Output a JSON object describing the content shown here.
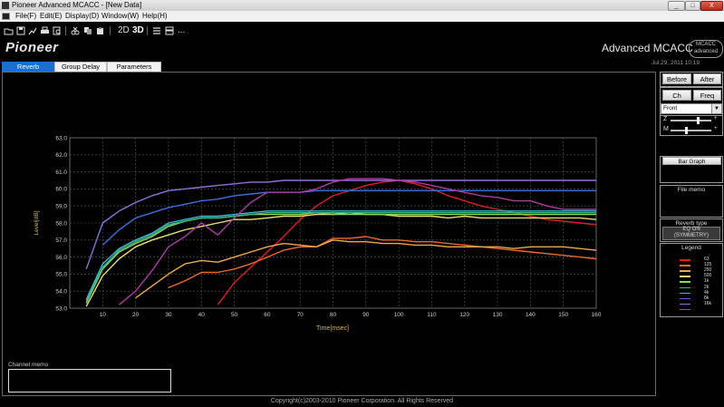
{
  "window": {
    "title": "Pioneer Advanced MCACC - [New Data]",
    "controls": [
      "_",
      "□",
      "X"
    ]
  },
  "menu": [
    "File(F)",
    "Edit(E)",
    "Display(D)",
    "Window(W)",
    "Help(H)"
  ],
  "toolbar": {
    "btn_2d": "2D",
    "btn_3d": "3D",
    "more": "..."
  },
  "header": {
    "logo": "Pioneer",
    "product": "Advanced MCACC",
    "badge": "MCACC advanced",
    "datetime": "Jul.29, 2011 10:19"
  },
  "tabs": [
    {
      "label": "Reverb",
      "active": true
    },
    {
      "label": "Group Delay",
      "active": false
    },
    {
      "label": "Parameters",
      "active": false
    }
  ],
  "right_panel": {
    "before": "Before",
    "after": "After",
    "ch": "Ch",
    "freq": "Freq",
    "channel_select": "Front",
    "z_label": "Z",
    "m_label": "M",
    "z_level": 0.65,
    "m_level": 0.35,
    "bar_graph": "Bar Graph",
    "file_memo": "File memo",
    "reverb_type_title": "Reverb type",
    "reverb_type_line1": "EQ ON",
    "reverb_type_line2": "(SYMMETRY)",
    "legend_title": "Legend"
  },
  "channel_memo": {
    "label": "Channel memo",
    "value": ""
  },
  "footer": {
    "copyright": "Copyright(c)2003-2010 Pioneer Corporation. All Rights Reserved"
  },
  "chart_data": {
    "type": "line",
    "title": "",
    "xlabel": "Time[msec]",
    "ylabel": "Level[dB]",
    "xlim": [
      0,
      160
    ],
    "ylim": [
      53.0,
      63.0
    ],
    "xticks": [
      10,
      20,
      30,
      40,
      50,
      60,
      70,
      80,
      90,
      100,
      110,
      120,
      130,
      140,
      150,
      160
    ],
    "yticks": [
      "53.0",
      "54.0",
      "55.0",
      "56.0",
      "57.0",
      "58.0",
      "59.0",
      "60.0",
      "61.0",
      "62.0",
      "63.0"
    ],
    "grid": true,
    "legend_position": "right panel",
    "x": [
      5,
      10,
      15,
      20,
      25,
      30,
      35,
      40,
      45,
      50,
      55,
      60,
      65,
      70,
      75,
      80,
      85,
      90,
      95,
      100,
      105,
      110,
      115,
      120,
      125,
      130,
      135,
      140,
      145,
      150,
      155,
      160
    ],
    "series": [
      {
        "name": "63",
        "color": "#e02020",
        "values": [
          null,
          null,
          null,
          null,
          null,
          null,
          null,
          null,
          53.2,
          54.5,
          55.4,
          56.3,
          57.2,
          58.2,
          59.0,
          59.6,
          59.9,
          60.2,
          60.4,
          60.5,
          60.3,
          60.0,
          59.6,
          59.3,
          59.0,
          58.8,
          58.6,
          58.4,
          58.2,
          58.1,
          58.0,
          57.9
        ]
      },
      {
        "name": "125",
        "color": "#ef6a2a",
        "values": [
          null,
          null,
          null,
          null,
          null,
          54.2,
          54.6,
          55.1,
          55.1,
          55.3,
          55.6,
          56.0,
          56.4,
          56.6,
          56.6,
          57.1,
          57.1,
          57.2,
          57.0,
          57.0,
          56.9,
          56.9,
          56.8,
          56.7,
          56.6,
          56.5,
          56.4,
          56.3,
          56.2,
          56.1,
          56.0,
          55.9
        ]
      },
      {
        "name": "250",
        "color": "#f0a74a",
        "values": [
          null,
          null,
          null,
          53.6,
          54.3,
          55.0,
          55.6,
          55.8,
          55.7,
          56.0,
          56.3,
          56.6,
          56.8,
          56.7,
          56.6,
          57.0,
          56.9,
          56.9,
          56.8,
          56.8,
          56.7,
          56.7,
          56.6,
          56.6,
          56.6,
          56.6,
          56.5,
          56.6,
          56.6,
          56.6,
          56.5,
          56.4
        ]
      },
      {
        "name": "500",
        "color": "#eae070",
        "values": [
          53.1,
          54.9,
          55.9,
          56.6,
          57.0,
          57.3,
          57.6,
          57.8,
          58.0,
          58.2,
          58.2,
          58.3,
          58.4,
          58.4,
          58.5,
          58.5,
          58.6,
          58.5,
          58.5,
          58.4,
          58.4,
          58.4,
          58.3,
          58.4,
          58.3,
          58.3,
          58.3,
          58.3,
          58.3,
          58.3,
          58.3,
          58.2
        ]
      },
      {
        "name": "1k",
        "color": "#8fd35a",
        "values": [
          53.3,
          55.3,
          56.3,
          56.8,
          57.2,
          57.8,
          58.1,
          58.3,
          58.3,
          58.4,
          58.5,
          58.5,
          58.5,
          58.5,
          58.6,
          58.5,
          58.5,
          58.5,
          58.5,
          58.5,
          58.5,
          58.5,
          58.5,
          58.5,
          58.5,
          58.5,
          58.5,
          58.5,
          58.5,
          58.5,
          58.5,
          58.5
        ]
      },
      {
        "name": "2k",
        "color": "#3cb878",
        "values": [
          53.4,
          55.4,
          56.4,
          56.9,
          57.3,
          57.9,
          58.1,
          58.3,
          58.3,
          58.4,
          58.5,
          58.6,
          58.6,
          58.6,
          58.6,
          58.6,
          58.6,
          58.6,
          58.6,
          58.6,
          58.6,
          58.6,
          58.6,
          58.6,
          58.6,
          58.6,
          58.6,
          58.6,
          58.6,
          58.6,
          58.6,
          58.6
        ]
      },
      {
        "name": "4k",
        "color": "#3ab8d8",
        "values": [
          53.5,
          55.6,
          56.5,
          57.0,
          57.4,
          58.0,
          58.2,
          58.4,
          58.4,
          58.5,
          58.6,
          58.7,
          58.7,
          58.7,
          58.7,
          58.7,
          58.7,
          58.7,
          58.7,
          58.7,
          58.7,
          58.7,
          58.7,
          58.7,
          58.7,
          58.7,
          58.7,
          58.7,
          58.7,
          58.7,
          58.7,
          58.7
        ]
      },
      {
        "name": "8k",
        "color": "#3a70e0",
        "values": [
          null,
          56.7,
          57.6,
          58.3,
          58.6,
          58.9,
          59.1,
          59.3,
          59.4,
          59.6,
          59.7,
          59.8,
          59.8,
          59.8,
          59.9,
          59.9,
          59.9,
          59.9,
          59.9,
          59.9,
          59.9,
          59.9,
          59.9,
          59.9,
          59.9,
          59.9,
          59.9,
          59.9,
          59.9,
          59.9,
          59.9,
          59.9
        ]
      },
      {
        "name": "16k",
        "color": "#9070e0",
        "values": [
          55.3,
          58.0,
          58.7,
          59.2,
          59.6,
          59.9,
          60.0,
          60.1,
          60.2,
          60.3,
          60.4,
          60.4,
          60.5,
          60.5,
          60.5,
          60.5,
          60.5,
          60.5,
          60.5,
          60.5,
          60.5,
          60.5,
          60.5,
          60.5,
          60.5,
          60.5,
          60.5,
          60.5,
          60.5,
          60.5,
          60.5,
          60.5
        ]
      },
      {
        "name": "",
        "color": "#b03aa8",
        "values": [
          null,
          null,
          53.2,
          54.0,
          55.2,
          56.6,
          57.2,
          58.0,
          57.3,
          58.3,
          59.2,
          59.8,
          59.8,
          59.8,
          60.0,
          60.4,
          60.6,
          60.6,
          60.6,
          60.5,
          60.4,
          60.2,
          60.0,
          59.8,
          59.6,
          59.5,
          59.3,
          59.3,
          59.0,
          58.8,
          58.8,
          58.8
        ]
      }
    ]
  }
}
